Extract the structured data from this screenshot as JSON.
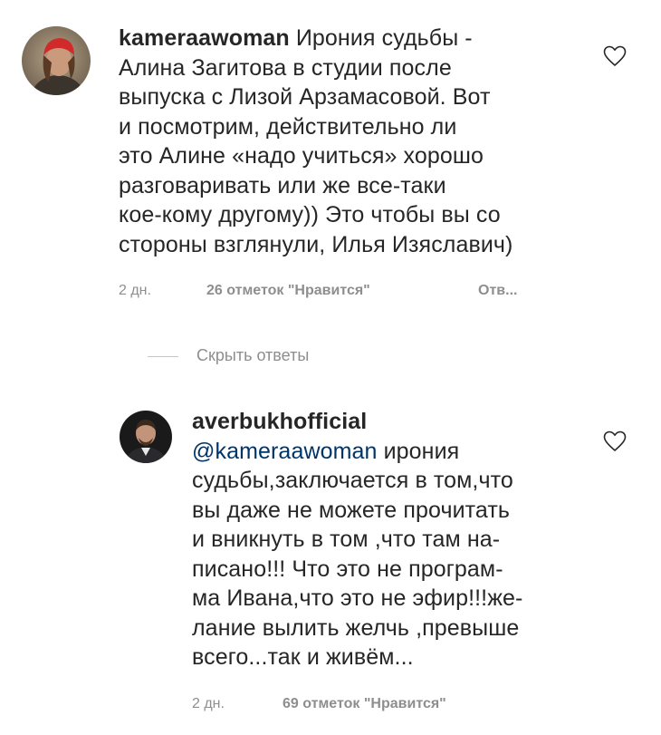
{
  "comments": [
    {
      "username": "kameraawoman",
      "lines": [
        "Ирония судьбы -",
        "Алина Загитова в студии после",
        "выпуска с Лизой Арзамасовой. Вот",
        "и посмотрим, действительно ли",
        "это Алине «надо учиться» хорошо",
        "разговаривать или же все-таки",
        "кое-кому другому)) Это чтобы вы со",
        "стороны взглянули, Илья Изяславич)"
      ],
      "time": "2 дн.",
      "likes": "26 отметок \"Нравится\"",
      "reply": "Отв..."
    }
  ],
  "hide_replies": "Скрыть ответы",
  "replies": [
    {
      "username": "averbukhofficial",
      "mention": "@kameraawoman",
      "first_line_rest": " ирония",
      "lines": [
        "судьбы,заключается в том,что",
        "вы даже не можете прочитать",
        "и вникнуть в том ,что там на-",
        "писано!!! Что это не програм-",
        "ма Ивана,что это не эфир!!!же-",
        "лание вылить желчь ,превыше",
        "всего...так и живём..."
      ],
      "time": "2 дн.",
      "likes": "69 отметок \"Нравится\""
    }
  ],
  "icons": {
    "like": "heart-outline-icon",
    "avatar_1": "avatar-photo",
    "avatar_2": "avatar-photo"
  },
  "colors": {
    "text": "#262626",
    "secondary": "#8e8e8e",
    "mention": "#003569"
  }
}
